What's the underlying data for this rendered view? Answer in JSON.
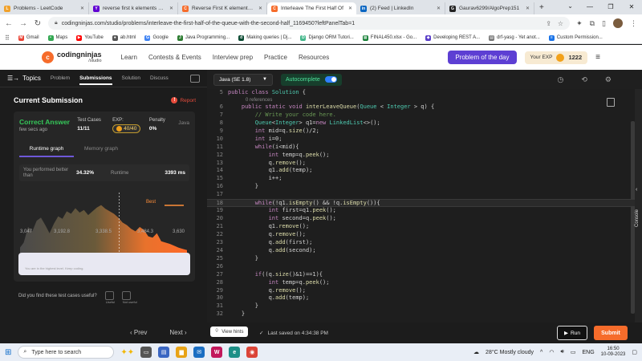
{
  "browser": {
    "tabs": [
      {
        "label": "Problems - LeetCode",
        "icon": "leetcode-icon",
        "color": "#f0a12c",
        "glyph": "L"
      },
      {
        "label": "reverse first k elements of q",
        "icon": "yahoo-icon",
        "color": "#6001d2",
        "glyph": "Y"
      },
      {
        "label": "Reverse First K elements of",
        "icon": "codingninjas-icon",
        "color": "#f66c2b",
        "glyph": "C"
      },
      {
        "label": "Interleave The First Half Of",
        "icon": "codingninjas-icon",
        "color": "#f66c2b",
        "glyph": "C"
      },
      {
        "label": "(2) Feed | LinkedIn",
        "icon": "linkedin-icon",
        "color": "#0a66c2",
        "glyph": "in"
      },
      {
        "label": "Gaurav6299/AlgoPrep151",
        "icon": "github-icon",
        "color": "#222222",
        "glyph": "G"
      }
    ],
    "active_tab": 3,
    "url": "codingninjas.com/studio/problems/interleave-the-first-half-of-the-queue-with-the-second-half_1169450?leftPanelTab=1",
    "bookmarks": [
      {
        "label": "Gmail",
        "color": "#ea4335",
        "glyph": "M"
      },
      {
        "label": "Maps",
        "color": "#34a853",
        "glyph": "•"
      },
      {
        "label": "YouTube",
        "color": "#ff0000",
        "glyph": "▶"
      },
      {
        "label": "ab.html",
        "color": "#555555",
        "glyph": "●"
      },
      {
        "label": "Google",
        "color": "#4285f4",
        "glyph": "G"
      },
      {
        "label": "Java Programming...",
        "color": "#2e7d32",
        "glyph": "J"
      },
      {
        "label": "Making queries | Dj...",
        "color": "#0c4b33",
        "glyph": "d"
      },
      {
        "label": "Django ORM Tutori...",
        "color": "#44b78b",
        "glyph": "D"
      },
      {
        "label": "FINAL450.xlsx - Go...",
        "color": "#188038",
        "glyph": "▦"
      },
      {
        "label": "Developing REST A...",
        "color": "#5a3ec8",
        "glyph": "◆"
      },
      {
        "label": "drf-yasg - Yet anot...",
        "color": "#777777",
        "glyph": "▤"
      },
      {
        "label": "Custom Permission...",
        "color": "#1a73e8",
        "glyph": "≡"
      }
    ]
  },
  "site": {
    "brand": "codingninjas",
    "brand_sub": "/studio",
    "nav": [
      "Learn",
      "Contests & Events",
      "Interview prep",
      "Practice",
      "Resources"
    ],
    "potd": "Problem of the day",
    "exp_label": "Your EXP",
    "exp_value": "1222"
  },
  "left": {
    "topics": "Topics",
    "tabs": [
      "Problem",
      "Submissions",
      "Solution",
      "Discuss"
    ],
    "selected_tab": 1,
    "title": "Current Submission",
    "report": "Report",
    "status": "Correct Answer",
    "time_ago": "few secs ago",
    "test_cases_label": "Test Cases",
    "test_cases_value": "11/11",
    "exp_label": "EXP:",
    "exp_value": "40/40",
    "penalty_label": "Penalty",
    "penalty_value": "0%",
    "language": "Java",
    "graph_tabs": [
      "Runtime graph",
      "Memory graph"
    ],
    "better_than_label": "You performed better than",
    "better_than_value": "34.32%",
    "runtime_label": "Runtime",
    "runtime_value": "3393 ms",
    "best_label": "Best",
    "info_text": "You are in the highest level. Keep coding.",
    "feedback_question": "Did you find these test cases useful?",
    "feedback_yes": "Useful",
    "feedback_no": "Not useful"
  },
  "chart_data": {
    "type": "area",
    "x_ticks": [
      "3,047",
      "3,192.8",
      "3,338.5",
      "3,484.3",
      "3,630"
    ],
    "xlim": [
      3047,
      3630
    ],
    "highlight_x": 3393,
    "x": [
      3047,
      3060,
      3075,
      3090,
      3105,
      3120,
      3135,
      3150,
      3165,
      3180,
      3195,
      3210,
      3225,
      3240,
      3255,
      3270,
      3285,
      3300,
      3315,
      3330,
      3345,
      3360,
      3375,
      3390,
      3405,
      3420,
      3435,
      3450,
      3465,
      3480,
      3495,
      3510,
      3525,
      3540,
      3555,
      3570,
      3585,
      3600,
      3615,
      3630
    ],
    "values": [
      12,
      20,
      45,
      38,
      55,
      60,
      48,
      35,
      50,
      62,
      58,
      70,
      66,
      75,
      68,
      72,
      64,
      70,
      76,
      80,
      74,
      70,
      66,
      60,
      52,
      48,
      42,
      38,
      45,
      40,
      30,
      28,
      35,
      22,
      20,
      18,
      15,
      12,
      10,
      8
    ],
    "ylim": [
      0,
      100
    ]
  },
  "editor": {
    "language": "Java (SE 1.8)",
    "autocomplete_label": "Autocomplete",
    "autocomplete_on": true,
    "references": "0 references",
    "highlighted_line": 18,
    "lines": [
      {
        "n": "5",
        "code": "public class Solution {"
      },
      {
        "n": "6",
        "code": "    public static void interLeaveQueue(Queue < Integer > q) {"
      },
      {
        "n": "7",
        "code": "        // Write your code here."
      },
      {
        "n": "8",
        "code": "        Queue<Integer> q1=new LinkedList<>();"
      },
      {
        "n": "9",
        "code": "        int mid=q.size()/2;"
      },
      {
        "n": "10",
        "code": "        int i=0;"
      },
      {
        "n": "11",
        "code": "        while(i<mid){"
      },
      {
        "n": "12",
        "code": "            int temp=q.peek();"
      },
      {
        "n": "13",
        "code": "            q.remove();"
      },
      {
        "n": "14",
        "code": "            q1.add(temp);"
      },
      {
        "n": "15",
        "code": "            i++;"
      },
      {
        "n": "16",
        "code": "        }"
      },
      {
        "n": "17",
        "code": ""
      },
      {
        "n": "18",
        "code": "        while(!q1.isEmpty() && !q.isEmpty()){"
      },
      {
        "n": "19",
        "code": "            int first=q1.peek();"
      },
      {
        "n": "20",
        "code": "            int second=q.peek();"
      },
      {
        "n": "21",
        "code": "            q1.remove();"
      },
      {
        "n": "22",
        "code": "            q.remove();"
      },
      {
        "n": "23",
        "code": "            q.add(first);"
      },
      {
        "n": "24",
        "code": "            q.add(second);"
      },
      {
        "n": "25",
        "code": "        }"
      },
      {
        "n": "26",
        "code": ""
      },
      {
        "n": "27",
        "code": "        if((q.size()&1)==1){"
      },
      {
        "n": "28",
        "code": "            int temp=q.peek();"
      },
      {
        "n": "29",
        "code": "            q.remove();"
      },
      {
        "n": "30",
        "code": "            q.add(temp);"
      },
      {
        "n": "31",
        "code": "        }"
      },
      {
        "n": "32",
        "code": "    }"
      }
    ],
    "console_label": "Console"
  },
  "footer": {
    "prev": "Prev",
    "next": "Next",
    "hints": "View hints",
    "saved": "Last saved on 4:34:38 PM",
    "run": "Run",
    "submit": "Submit"
  },
  "taskbar": {
    "search_placeholder": "Type here to search",
    "weather": "28°C  Mostly cloudy",
    "lang": "ENG",
    "time": "16:50",
    "date": "10-09-2023"
  }
}
